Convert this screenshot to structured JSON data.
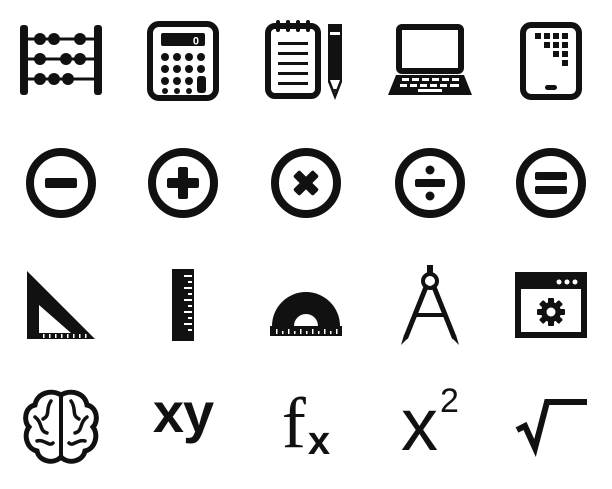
{
  "icons": [
    {
      "name": "abacus-icon"
    },
    {
      "name": "calculator-icon",
      "display": "0"
    },
    {
      "name": "notepad-pencil-icon"
    },
    {
      "name": "laptop-icon"
    },
    {
      "name": "tablet-icon"
    },
    {
      "name": "minus-icon"
    },
    {
      "name": "plus-icon"
    },
    {
      "name": "multiply-icon"
    },
    {
      "name": "divide-icon"
    },
    {
      "name": "equals-icon"
    },
    {
      "name": "set-square-icon"
    },
    {
      "name": "ruler-icon"
    },
    {
      "name": "protractor-icon"
    },
    {
      "name": "compass-icon"
    },
    {
      "name": "settings-window-icon"
    },
    {
      "name": "brain-icon"
    },
    {
      "name": "xy-variables-icon",
      "text": "xy"
    },
    {
      "name": "function-icon",
      "text_f": "f",
      "text_x": "x"
    },
    {
      "name": "x-squared-icon",
      "text_x": "x",
      "text_exp": "2"
    },
    {
      "name": "square-root-icon"
    }
  ],
  "colors": {
    "ink": "#111111",
    "background": "#ffffff"
  }
}
